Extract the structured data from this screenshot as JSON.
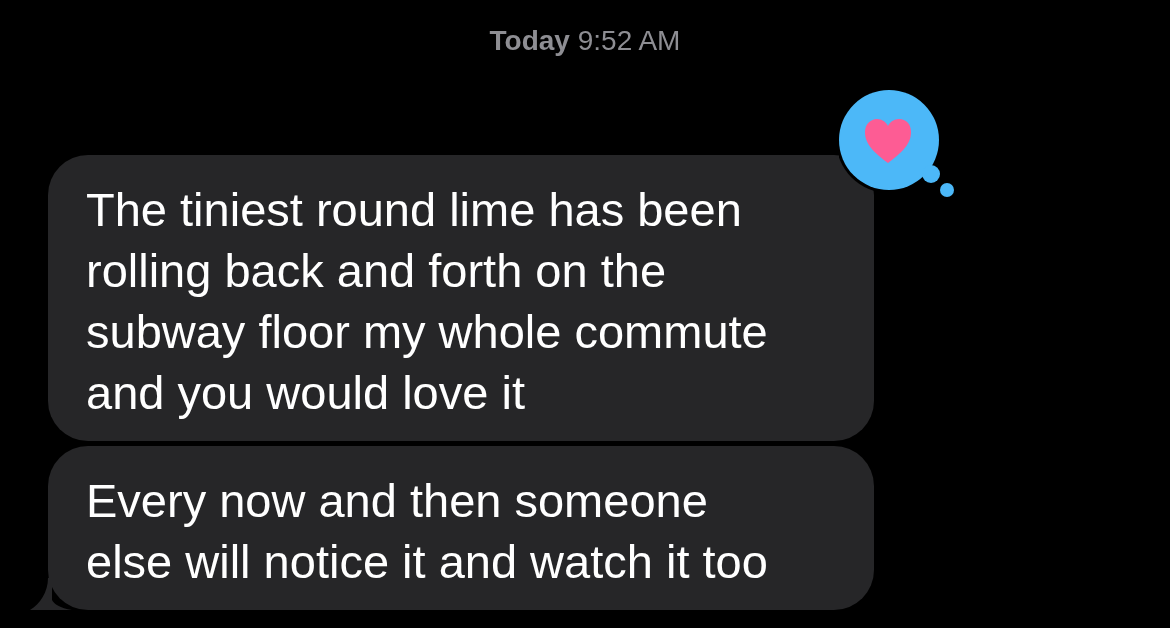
{
  "header": {
    "timestamp": "**Today** 9:52 AM"
  },
  "messages": [
    {
      "text": "The tiniest round lime has been rolling back and forth on the subway floor my whole commute and you would love it",
      "tapback": true,
      "tail": false
    },
    {
      "text": "Every now and then someone else will notice it and watch it too",
      "tapback": false,
      "tail": true
    }
  ]
}
